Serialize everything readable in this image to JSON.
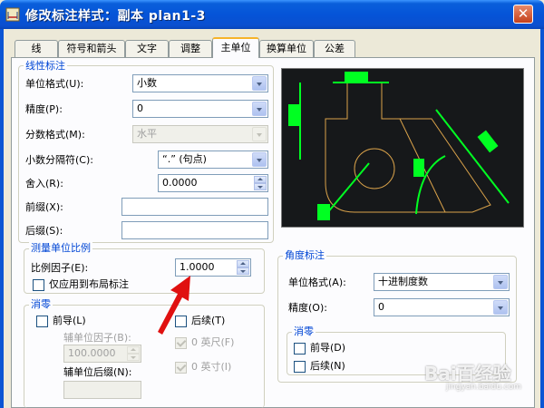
{
  "window": {
    "title": "修改标注样式：副本 plan1-3",
    "close": "✕"
  },
  "tabs": [
    {
      "label": "线"
    },
    {
      "label": "符号和箭头"
    },
    {
      "label": "文字"
    },
    {
      "label": "调整"
    },
    {
      "label": "主单位"
    },
    {
      "label": "换算单位"
    },
    {
      "label": "公差"
    }
  ],
  "active_tab": "主单位",
  "linear": {
    "title": "线性标注",
    "unit_format_label": "单位格式(U):",
    "unit_format_value": "小数",
    "precision_label": "精度(P):",
    "precision_value": "0",
    "fraction_label": "分数格式(M):",
    "fraction_value": "水平",
    "decimal_sep_label": "小数分隔符(C):",
    "decimal_sep_value": "“.” (句点)",
    "round_label": "舍入(R):",
    "round_value": "0.0000",
    "prefix_label": "前缀(X):",
    "prefix_value": "",
    "suffix_label": "后缀(S):",
    "suffix_value": ""
  },
  "scale": {
    "title": "测量单位比例",
    "factor_label": "比例因子(E):",
    "factor_value": "1.0000",
    "layout_only_label": "仅应用到布局标注"
  },
  "zero": {
    "title": "消零",
    "leading_label": "前导(L)",
    "sub_factor_label": "辅单位因子(B):",
    "sub_factor_value": "100.0000",
    "sub_suffix_label": "辅单位后缀(N):",
    "sub_suffix_value": "",
    "trailing_label": "后续(T)",
    "feet_label": "0 英尺(F)",
    "inch_label": "0 英寸(I)"
  },
  "angular": {
    "title": "角度标注",
    "unit_format_label": "单位格式(A):",
    "unit_format_value": "十进制度数",
    "precision_label": "精度(O):",
    "precision_value": "0",
    "zero_title": "消零",
    "leading_label": "前导(D)",
    "trailing_label": "后续(N)"
  },
  "watermark": {
    "text": "Bai百经验",
    "sub": "jingyan.baidu.com"
  },
  "colors": {
    "preview_bg": "#16181a",
    "dim_green": "#00ff22",
    "geom_orange": "#d9a24a",
    "arrow_red": "#e01010"
  }
}
